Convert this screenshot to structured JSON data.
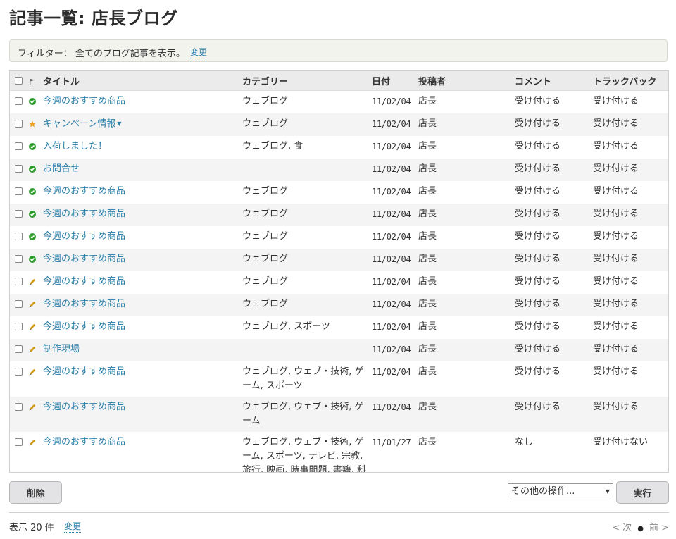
{
  "page_title": "記事一覧: 店長ブログ",
  "filter": {
    "label": "フィルター： 全てのブログ記事を表示。",
    "change_link": "変更"
  },
  "table": {
    "headers": {
      "title": "タイトル",
      "category": "カテゴリー",
      "date": "日付",
      "author": "投稿者",
      "comment": "コメント",
      "trackback": "トラックバック"
    },
    "rows": [
      {
        "status": "published",
        "title": "今週のおすすめ商品",
        "category": "ウェブログ",
        "date": "11/02/04",
        "author": "店長",
        "comment": "受け付ける",
        "trackback": "受け付ける"
      },
      {
        "status": "featured",
        "title": "キャンペーン情報",
        "category": "ウェブログ",
        "date": "11/02/04",
        "author": "店長",
        "comment": "受け付ける",
        "trackback": "受け付ける"
      },
      {
        "status": "published",
        "title": "入荷しました！",
        "category": "ウェブログ, 食",
        "date": "11/02/04",
        "author": "店長",
        "comment": "受け付ける",
        "trackback": "受け付ける"
      },
      {
        "status": "published",
        "title": "お問合せ",
        "category": "",
        "date": "11/02/04",
        "author": "店長",
        "comment": "受け付ける",
        "trackback": "受け付ける"
      },
      {
        "status": "published",
        "title": "今週のおすすめ商品",
        "category": "ウェブログ",
        "date": "11/02/04",
        "author": "店長",
        "comment": "受け付ける",
        "trackback": "受け付ける"
      },
      {
        "status": "published",
        "title": "今週のおすすめ商品",
        "category": "ウェブログ",
        "date": "11/02/04",
        "author": "店長",
        "comment": "受け付ける",
        "trackback": "受け付ける"
      },
      {
        "status": "published",
        "title": "今週のおすすめ商品",
        "category": "ウェブログ",
        "date": "11/02/04",
        "author": "店長",
        "comment": "受け付ける",
        "trackback": "受け付ける"
      },
      {
        "status": "published",
        "title": "今週のおすすめ商品",
        "category": "ウェブログ",
        "date": "11/02/04",
        "author": "店長",
        "comment": "受け付ける",
        "trackback": "受け付ける"
      },
      {
        "status": "draft",
        "title": "今週のおすすめ商品",
        "category": "ウェブログ",
        "date": "11/02/04",
        "author": "店長",
        "comment": "受け付ける",
        "trackback": "受け付ける"
      },
      {
        "status": "draft",
        "title": "今週のおすすめ商品",
        "category": "ウェブログ",
        "date": "11/02/04",
        "author": "店長",
        "comment": "受け付ける",
        "trackback": "受け付ける"
      },
      {
        "status": "draft",
        "title": "今週のおすすめ商品",
        "category": "ウェブログ, スポーツ",
        "date": "11/02/04",
        "author": "店長",
        "comment": "受け付ける",
        "trackback": "受け付ける"
      },
      {
        "status": "draft",
        "title": "制作現場",
        "category": "",
        "date": "11/02/04",
        "author": "店長",
        "comment": "受け付ける",
        "trackback": "受け付ける"
      },
      {
        "status": "draft",
        "title": "今週のおすすめ商品",
        "category": "ウェブログ, ウェブ・技術, ゲーム, スポーツ",
        "date": "11/02/04",
        "author": "店長",
        "comment": "受け付ける",
        "trackback": "受け付ける"
      },
      {
        "status": "draft",
        "title": "今週のおすすめ商品",
        "category": "ウェブログ, ウェブ・技術, ゲーム",
        "date": "11/02/04",
        "author": "店長",
        "comment": "受け付ける",
        "trackback": "受け付ける"
      },
      {
        "status": "draft",
        "title": "今週のおすすめ商品",
        "category": "ウェブログ, ウェブ・技術, ゲーム, スポーツ, テレビ, 宗教, 旅行, 映画, 時事問題, 書籍, 科学, 音楽, 食",
        "date": "11/01/27",
        "author": "店長",
        "comment": "なし",
        "trackback": "受け付けない"
      }
    ]
  },
  "actions": {
    "delete_label": "削除",
    "more_actions_label": "その他の操作...",
    "execute_label": "実行"
  },
  "footer": {
    "display_label": "表示 20 件",
    "change_link": "変更",
    "next_label": "< 次",
    "prev_label": "前 >"
  },
  "colors": {
    "link": "#2a7fa8",
    "published": "#2e9c2e",
    "featured": "#f0a020",
    "draft": "#d49b16"
  }
}
